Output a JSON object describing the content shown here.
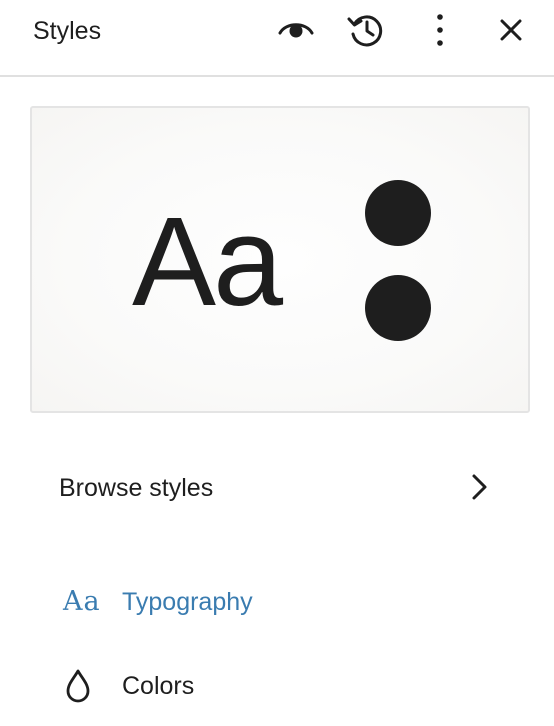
{
  "header": {
    "title": "Styles",
    "icons": {
      "preview": "eye-icon",
      "revisions": "history-icon",
      "more": "vertical-ellipsis-icon",
      "close": "close-icon"
    }
  },
  "preview_card": {
    "sample_text": "Aa",
    "swatch_colors": [
      "#1e1e1e",
      "#1e1e1e"
    ]
  },
  "browse": {
    "label": "Browse styles",
    "icon": "chevron-right-icon"
  },
  "nav": [
    {
      "label": "Typography",
      "icon_text": "Aa",
      "icon": "typography-icon",
      "color": "#3a7cb0"
    },
    {
      "label": "Colors",
      "icon": "droplet-icon",
      "color": "#1e1e1e"
    }
  ],
  "colors": {
    "text": "#1e1e1e",
    "accent": "#3a7cb0",
    "divider": "#e0e0e0"
  }
}
